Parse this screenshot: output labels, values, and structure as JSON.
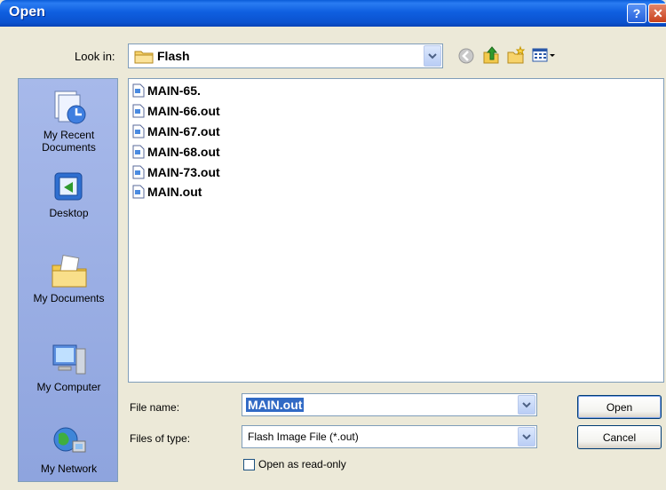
{
  "window": {
    "title": "Open",
    "help_glyph": "?",
    "close_glyph": "✕"
  },
  "lookin": {
    "label": "Look in:",
    "value": "Flash"
  },
  "places": [
    {
      "label": "My Recent Documents",
      "icon": "recent-documents-icon"
    },
    {
      "label": "Desktop",
      "icon": "desktop-icon"
    },
    {
      "label": "My Documents",
      "icon": "my-documents-icon"
    },
    {
      "label": "My Computer",
      "icon": "my-computer-icon"
    },
    {
      "label": "My Network",
      "icon": "my-network-icon"
    }
  ],
  "files": [
    "MAIN-65.",
    "MAIN-66.out",
    "MAIN-67.out",
    "MAIN-68.out",
    "MAIN-73.out",
    "MAIN.out"
  ],
  "filename": {
    "label": "File name:",
    "value": "MAIN.out"
  },
  "filetype": {
    "label": "Files of type:",
    "value": "Flash Image File (*.out)"
  },
  "buttons": {
    "open": "Open",
    "cancel": "Cancel"
  },
  "readonly": {
    "label": "Open as read-only",
    "checked": false
  },
  "colors": {
    "title_bar": "#0b52cf",
    "selection": "#316ac5",
    "dialog_bg": "#ece9d8"
  }
}
